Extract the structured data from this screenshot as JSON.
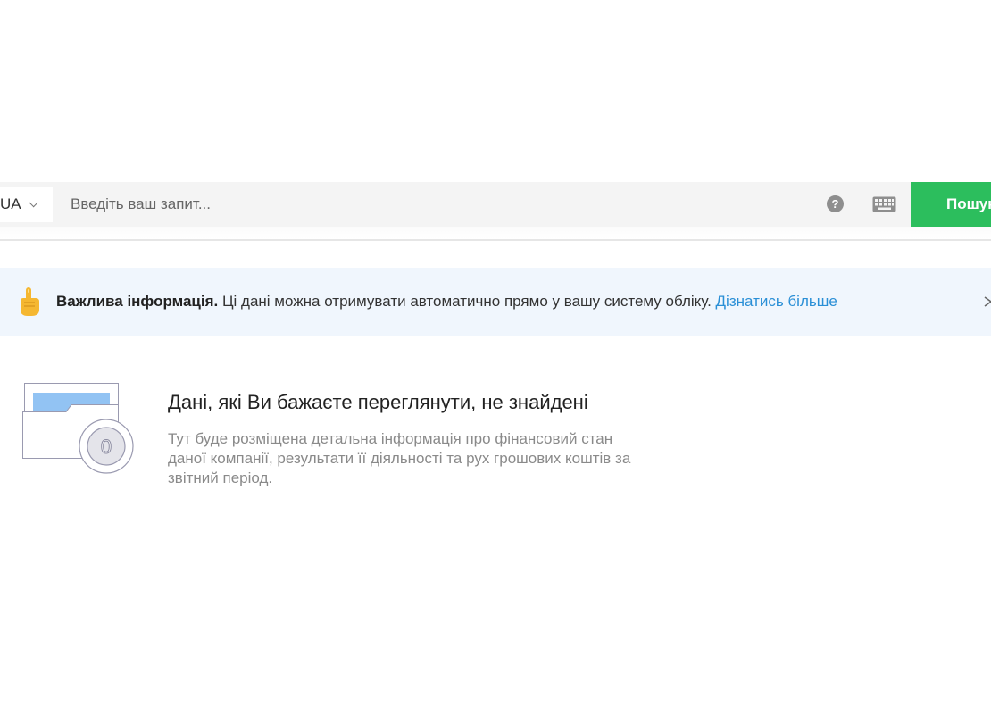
{
  "search": {
    "country_code": "UA",
    "placeholder": "Введіть ваш запит...",
    "value": "",
    "help_symbol": "?",
    "button_label": "Пошук"
  },
  "banner": {
    "icon": "pointing-up-hand-icon",
    "bold_text": "Важлива інформація.",
    "text": " Ці дані можна отримувати автоматично прямо у вашу систему обліку. ",
    "link_text": "Дізнатись більше"
  },
  "empty_state": {
    "icon": "empty-folder-icon",
    "title": "Дані, які Ви бажаєте переглянути, не знайдені",
    "description": "Тут буде розміщена детальна інформація про фінансовий стан даної компанії, результати її діяльності та рух грошових коштів за звітний період.",
    "illustration_digit": "0"
  },
  "colors": {
    "accent_green": "#2cbe5d",
    "link_blue": "#2a8fd6",
    "banner_bg": "#f0f6fd",
    "search_bg": "#f4f4f4"
  }
}
